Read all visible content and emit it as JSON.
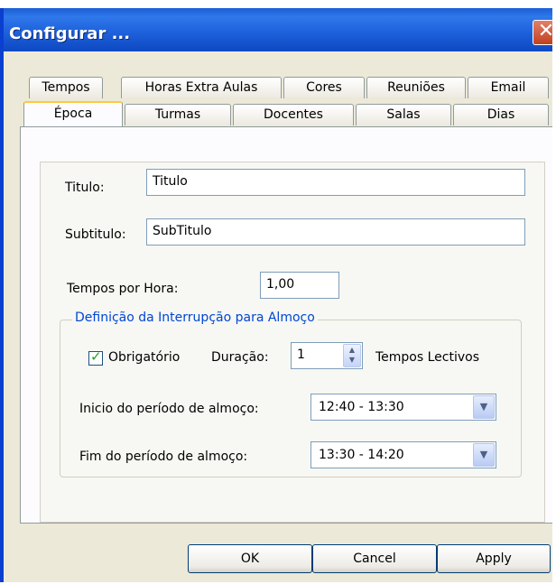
{
  "window": {
    "title": "Configurar ...",
    "close_glyph": "✕"
  },
  "tabs_back": [
    "Tempos",
    "Horas Extra Aulas",
    "Cores",
    "Reuniões",
    "Email"
  ],
  "tabs_front": [
    "Época",
    "Turmas",
    "Docentes",
    "Salas",
    "Dias"
  ],
  "selected_tab": "Época",
  "form": {
    "titulo_label": "Titulo:",
    "titulo_value": "Titulo",
    "subtitulo_label": "Subtitulo:",
    "subtitulo_value": "SubTitulo",
    "tempos_label": "Tempos por Hora:",
    "tempos_value": "1,00"
  },
  "lunch": {
    "legend": "Definição da Interrupção para Almoço",
    "obrigatorio_label": "Obrigatório",
    "obrigatorio_checked": true,
    "duracao_label": "Duração:",
    "duracao_value": "1",
    "duracao_unit": "Tempos Lectivos",
    "inicio_label": "Inicio do período de almoço:",
    "inicio_value": "12:40 - 13:30",
    "fim_label": "Fim do período de almoço:",
    "fim_value": "13:30 - 14:20"
  },
  "buttons": {
    "ok": "OK",
    "cancel": "Cancel",
    "apply": "Apply"
  },
  "icons": {
    "checkmark": "check-icon",
    "spin": "spin-arrows-icon",
    "dropdown": "chevron-down-icon",
    "close": "close-icon"
  }
}
